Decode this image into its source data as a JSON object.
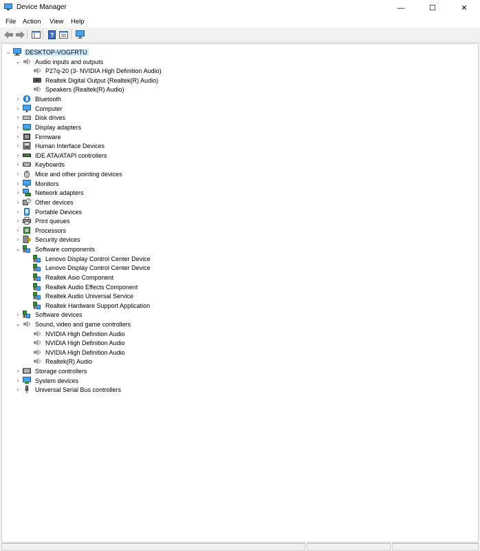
{
  "window": {
    "title": "Device Manager",
    "min": "—",
    "max": "☐",
    "close": "✕"
  },
  "menu": [
    "File",
    "Action",
    "View",
    "Help"
  ],
  "colors": {
    "selection": "#cce8ff",
    "accent": "#1e7ad6"
  },
  "tree": {
    "root": {
      "label": "DESKTOP-VOGFRTU",
      "icon": "computer-icon"
    },
    "items": [
      {
        "label": "Audio inputs and outputs",
        "icon": "speaker-icon",
        "expanded": true,
        "children": [
          {
            "label": "P27q-20 (3- NVIDIA High Definition Audio)",
            "icon": "speaker-icon"
          },
          {
            "label": "Realtek Digital Output (Realtek(R) Audio)",
            "icon": "digital-output-icon"
          },
          {
            "label": "Speakers (Realtek(R) Audio)",
            "icon": "speaker-icon"
          }
        ]
      },
      {
        "label": "Bluetooth",
        "icon": "bluetooth-icon"
      },
      {
        "label": "Computer",
        "icon": "monitor-icon"
      },
      {
        "label": "Disk drives",
        "icon": "disk-drive-icon"
      },
      {
        "label": "Display adapters",
        "icon": "display-adapter-icon"
      },
      {
        "label": "Firmware",
        "icon": "firmware-icon"
      },
      {
        "label": "Human Interface Devices",
        "icon": "hid-icon"
      },
      {
        "label": "IDE ATA/ATAPI controllers",
        "icon": "ide-controller-icon"
      },
      {
        "label": "Keyboards",
        "icon": "keyboard-icon"
      },
      {
        "label": "Mice and other pointing devices",
        "icon": "mouse-icon"
      },
      {
        "label": "Monitors",
        "icon": "monitor-icon"
      },
      {
        "label": "Network adapters",
        "icon": "network-adapter-icon"
      },
      {
        "label": "Other devices",
        "icon": "unknown-device-icon"
      },
      {
        "label": "Portable Devices",
        "icon": "portable-device-icon"
      },
      {
        "label": "Print queues",
        "icon": "printer-icon"
      },
      {
        "label": "Processors",
        "icon": "processor-icon"
      },
      {
        "label": "Security devices",
        "icon": "security-key-icon"
      },
      {
        "label": "Software components",
        "icon": "software-component-icon",
        "expanded": true,
        "children": [
          {
            "label": "Lenovo Display Control Center Device",
            "icon": "software-component-icon"
          },
          {
            "label": "Lenovo Display Control Center Device",
            "icon": "software-component-icon"
          },
          {
            "label": "Realtek Asio Component",
            "icon": "software-component-icon"
          },
          {
            "label": "Realtek Audio Effects Component",
            "icon": "software-component-icon"
          },
          {
            "label": "Realtek Audio Universal Service",
            "icon": "software-component-icon"
          },
          {
            "label": "Realtek Hardware Support Application",
            "icon": "software-component-icon"
          }
        ]
      },
      {
        "label": "Software devices",
        "icon": "software-component-icon"
      },
      {
        "label": "Sound, video and game controllers",
        "icon": "speaker-icon",
        "expanded": true,
        "children": [
          {
            "label": "NVIDIA High Definition Audio",
            "icon": "speaker-icon"
          },
          {
            "label": "NVIDIA High Definition Audio",
            "icon": "speaker-icon"
          },
          {
            "label": "NVIDIA High Definition Audio",
            "icon": "speaker-icon"
          },
          {
            "label": "Realtek(R) Audio",
            "icon": "speaker-icon"
          }
        ]
      },
      {
        "label": "Storage controllers",
        "icon": "storage-controller-icon"
      },
      {
        "label": "System devices",
        "icon": "system-device-icon"
      },
      {
        "label": "Universal Serial Bus controllers",
        "icon": "usb-icon"
      }
    ]
  }
}
